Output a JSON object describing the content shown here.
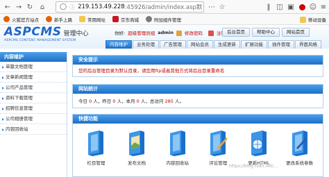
{
  "browser": {
    "url_host": "219.153.49.228",
    "url_path": ":45926/admin/index.asp默",
    "bookmarks": [
      {
        "label": "火狐官方站点",
        "color": "#e66000"
      },
      {
        "label": "新手上路",
        "color": "#e66000"
      },
      {
        "label": "常用网址",
        "color": "#f2c94c"
      },
      {
        "label": "京东商城",
        "color": "#c81623"
      },
      {
        "label": "附加组件管理",
        "color": "#7a7a7a"
      }
    ],
    "mobile_bookmarks": "移动设备"
  },
  "header": {
    "logo_text": "ASPCMS",
    "logo_cn": "管理中心",
    "logo_sub": "ASPCMS CONTENT MANAGEMENT SYSTEM",
    "greeting": "你好:",
    "role": "超级管理员组",
    "username": "admin",
    "change_pwd": "修改密码",
    "logout": "注销登录",
    "top_buttons": [
      "后台首页",
      "帮助中心",
      "网站首页"
    ]
  },
  "nav": {
    "tabs": [
      "内容维护",
      "业务处理",
      "广告管理",
      "网站会员",
      "生成更新",
      "扩展功能",
      "插件管理",
      "界面风格"
    ],
    "active_index": 0
  },
  "sidebar": {
    "title": "内容维护",
    "items": [
      "单篇文档管理",
      "文章新闻管理",
      "公司产品管理",
      "资料下载管理",
      "招聘信息管理",
      "公司相册管理",
      "内容回收站"
    ]
  },
  "security": {
    "title": "安全提示",
    "message": "您的后台管理目录为默认目录，请您用ftp或者其他方式将后台目录重命名"
  },
  "stats": {
    "title": "网站统计",
    "today_label": "今日",
    "today": "0",
    "yesterday_label": "人，昨日",
    "yesterday": "0",
    "month_label": "人，本月",
    "month": "0",
    "total_label": "人，总访问",
    "total": "285",
    "suffix": "人。"
  },
  "quick": {
    "title": "快捷功能",
    "items": [
      {
        "label": "栏目管理",
        "icon": "folder-icon"
      },
      {
        "label": "发布文档",
        "icon": "folder-image-icon"
      },
      {
        "label": "内容回收站",
        "icon": "folder-icon"
      },
      {
        "label": "评论管理",
        "icon": "folder-pen-icon"
      },
      {
        "label": "更新HTML",
        "icon": "folder-globe-icon"
      },
      {
        "label": "更改系统参数",
        "icon": "folder-edit-icon"
      }
    ]
  },
  "watermark": "https://blog.csdn.net/..."
}
